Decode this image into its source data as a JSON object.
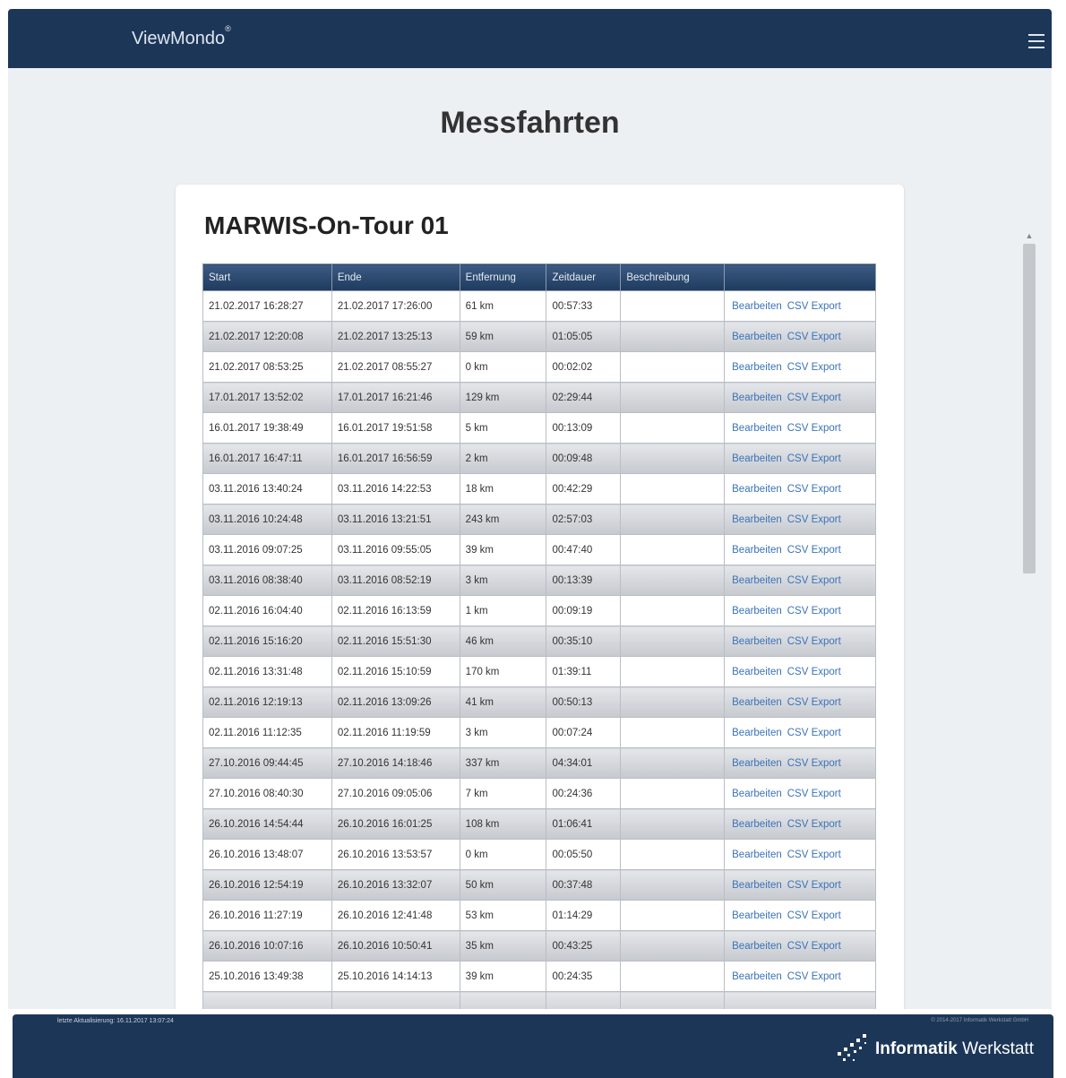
{
  "header": {
    "brand": "ViewMondo",
    "brand_mark": "®",
    "menu_icon": "hamburger-icon"
  },
  "page": {
    "title": "Messfahrten"
  },
  "card": {
    "title": "MARWIS-On-Tour 01"
  },
  "table": {
    "headers": [
      "Start",
      "Ende",
      "Entfernung",
      "Zeitdauer",
      "Beschreibung",
      ""
    ],
    "rows": [
      {
        "start": "21.02.2017 16:28:27",
        "end": "21.02.2017 17:26:00",
        "distance": "61 km",
        "duration": "00:57:33",
        "desc": "",
        "edit": "Bearbeiten",
        "export": "CSV Export"
      },
      {
        "start": "21.02.2017 12:20:08",
        "end": "21.02.2017 13:25:13",
        "distance": "59 km",
        "duration": "01:05:05",
        "desc": "",
        "edit": "Bearbeiten",
        "export": "CSV Export"
      },
      {
        "start": "21.02.2017 08:53:25",
        "end": "21.02.2017 08:55:27",
        "distance": "0 km",
        "duration": "00:02:02",
        "desc": "",
        "edit": "Bearbeiten",
        "export": "CSV Export"
      },
      {
        "start": "17.01.2017 13:52:02",
        "end": "17.01.2017 16:21:46",
        "distance": "129 km",
        "duration": "02:29:44",
        "desc": "",
        "edit": "Bearbeiten",
        "export": "CSV Export"
      },
      {
        "start": "16.01.2017 19:38:49",
        "end": "16.01.2017 19:51:58",
        "distance": "5 km",
        "duration": "00:13:09",
        "desc": "",
        "edit": "Bearbeiten",
        "export": "CSV Export"
      },
      {
        "start": "16.01.2017 16:47:11",
        "end": "16.01.2017 16:56:59",
        "distance": "2 km",
        "duration": "00:09:48",
        "desc": "",
        "edit": "Bearbeiten",
        "export": "CSV Export"
      },
      {
        "start": "03.11.2016 13:40:24",
        "end": "03.11.2016 14:22:53",
        "distance": "18 km",
        "duration": "00:42:29",
        "desc": "",
        "edit": "Bearbeiten",
        "export": "CSV Export"
      },
      {
        "start": "03.11.2016 10:24:48",
        "end": "03.11.2016 13:21:51",
        "distance": "243 km",
        "duration": "02:57:03",
        "desc": "",
        "edit": "Bearbeiten",
        "export": "CSV Export"
      },
      {
        "start": "03.11.2016 09:07:25",
        "end": "03.11.2016 09:55:05",
        "distance": "39 km",
        "duration": "00:47:40",
        "desc": "",
        "edit": "Bearbeiten",
        "export": "CSV Export"
      },
      {
        "start": "03.11.2016 08:38:40",
        "end": "03.11.2016 08:52:19",
        "distance": "3 km",
        "duration": "00:13:39",
        "desc": "",
        "edit": "Bearbeiten",
        "export": "CSV Export"
      },
      {
        "start": "02.11.2016 16:04:40",
        "end": "02.11.2016 16:13:59",
        "distance": "1 km",
        "duration": "00:09:19",
        "desc": "",
        "edit": "Bearbeiten",
        "export": "CSV Export"
      },
      {
        "start": "02.11.2016 15:16:20",
        "end": "02.11.2016 15:51:30",
        "distance": "46 km",
        "duration": "00:35:10",
        "desc": "",
        "edit": "Bearbeiten",
        "export": "CSV Export"
      },
      {
        "start": "02.11.2016 13:31:48",
        "end": "02.11.2016 15:10:59",
        "distance": "170 km",
        "duration": "01:39:11",
        "desc": "",
        "edit": "Bearbeiten",
        "export": "CSV Export"
      },
      {
        "start": "02.11.2016 12:19:13",
        "end": "02.11.2016 13:09:26",
        "distance": "41 km",
        "duration": "00:50:13",
        "desc": "",
        "edit": "Bearbeiten",
        "export": "CSV Export"
      },
      {
        "start": "02.11.2016 11:12:35",
        "end": "02.11.2016 11:19:59",
        "distance": "3 km",
        "duration": "00:07:24",
        "desc": "",
        "edit": "Bearbeiten",
        "export": "CSV Export"
      },
      {
        "start": "27.10.2016 09:44:45",
        "end": "27.10.2016 14:18:46",
        "distance": "337 km",
        "duration": "04:34:01",
        "desc": "",
        "edit": "Bearbeiten",
        "export": "CSV Export"
      },
      {
        "start": "27.10.2016 08:40:30",
        "end": "27.10.2016 09:05:06",
        "distance": "7 km",
        "duration": "00:24:36",
        "desc": "",
        "edit": "Bearbeiten",
        "export": "CSV Export"
      },
      {
        "start": "26.10.2016 14:54:44",
        "end": "26.10.2016 16:01:25",
        "distance": "108 km",
        "duration": "01:06:41",
        "desc": "",
        "edit": "Bearbeiten",
        "export": "CSV Export"
      },
      {
        "start": "26.10.2016 13:48:07",
        "end": "26.10.2016 13:53:57",
        "distance": "0 km",
        "duration": "00:05:50",
        "desc": "",
        "edit": "Bearbeiten",
        "export": "CSV Export"
      },
      {
        "start": "26.10.2016 12:54:19",
        "end": "26.10.2016 13:32:07",
        "distance": "50 km",
        "duration": "00:37:48",
        "desc": "",
        "edit": "Bearbeiten",
        "export": "CSV Export"
      },
      {
        "start": "26.10.2016 11:27:19",
        "end": "26.10.2016 12:41:48",
        "distance": "53 km",
        "duration": "01:14:29",
        "desc": "",
        "edit": "Bearbeiten",
        "export": "CSV Export"
      },
      {
        "start": "26.10.2016 10:07:16",
        "end": "26.10.2016 10:50:41",
        "distance": "35 km",
        "duration": "00:43:25",
        "desc": "",
        "edit": "Bearbeiten",
        "export": "CSV Export"
      },
      {
        "start": "25.10.2016 13:49:38",
        "end": "25.10.2016 14:14:13",
        "distance": "39 km",
        "duration": "00:24:35",
        "desc": "",
        "edit": "Bearbeiten",
        "export": "CSV Export"
      },
      {
        "start": "",
        "end": "",
        "distance": "",
        "duration": "",
        "desc": "",
        "edit": "",
        "export": ""
      }
    ]
  },
  "footer": {
    "last_update": "letzte Aktualisierung: 16.11.2017 13:07:24",
    "copyright": "© 2014-2017 Informatik Werkstatt GmbH",
    "logo_bold": "Informatik",
    "logo_regular": " Werkstatt",
    "logo_icon": "informatik-werkstatt-logo-icon"
  },
  "colors": {
    "header_bg": "#1c3658",
    "link": "#3a73b8",
    "content_bg": "#edf0f3"
  }
}
